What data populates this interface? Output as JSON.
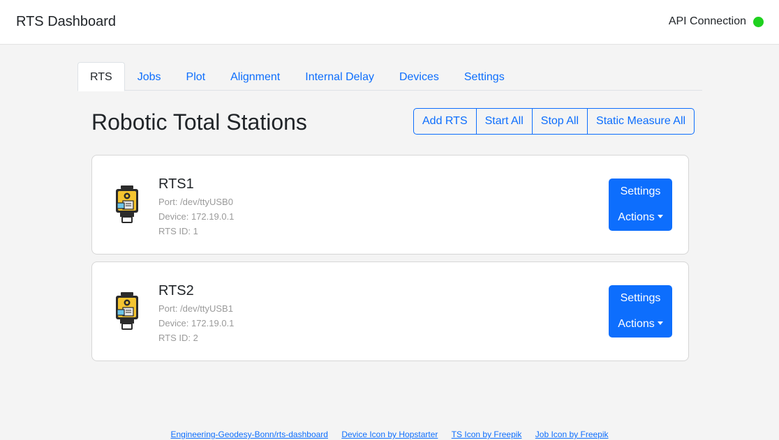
{
  "header": {
    "title": "RTS Dashboard",
    "api_label": "API Connection",
    "api_status_color": "#1fd11f"
  },
  "tabs": [
    {
      "label": "RTS",
      "active": true
    },
    {
      "label": "Jobs"
    },
    {
      "label": "Plot"
    },
    {
      "label": "Alignment"
    },
    {
      "label": "Internal Delay"
    },
    {
      "label": "Devices"
    },
    {
      "label": "Settings"
    }
  ],
  "main": {
    "title": "Robotic Total Stations",
    "buttons": {
      "add": "Add RTS",
      "start_all": "Start All",
      "stop_all": "Stop All",
      "static_measure_all": "Static Measure All"
    }
  },
  "stations": [
    {
      "name": "RTS1",
      "port": "Port: /dev/ttyUSB0",
      "device": "Device: 172.19.0.1",
      "rts_id": "RTS ID: 1",
      "settings_label": "Settings",
      "actions_label": "Actions",
      "icon": "total-station-icon"
    },
    {
      "name": "RTS2",
      "port": "Port: /dev/ttyUSB1",
      "device": "Device: 172.19.0.1",
      "rts_id": "RTS ID: 2",
      "settings_label": "Settings",
      "actions_label": "Actions",
      "icon": "total-station-icon"
    }
  ],
  "footer": {
    "links": [
      "Engineering-Geodesy-Bonn/rts-dashboard",
      "Device Icon by Hopstarter",
      "TS Icon by Freepik",
      "Job Icon by Freepik"
    ]
  },
  "colors": {
    "accent": "#0d6efd",
    "background": "#f4f4f4"
  }
}
